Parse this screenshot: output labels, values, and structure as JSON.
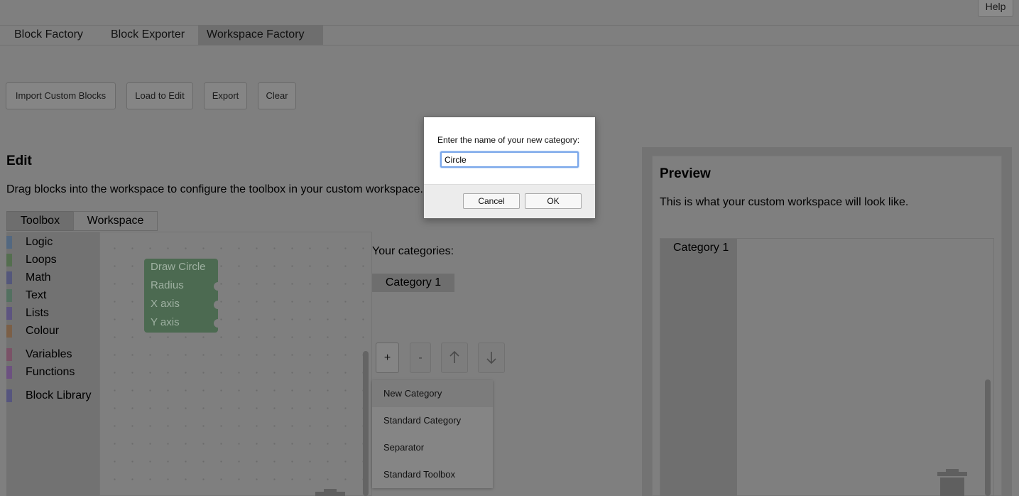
{
  "header": {
    "help_label": "Help"
  },
  "tabs": [
    {
      "label": "Block Factory",
      "active": false
    },
    {
      "label": "Block Exporter",
      "active": false
    },
    {
      "label": "Workspace Factory",
      "active": true
    }
  ],
  "actions": {
    "import": "Import Custom Blocks",
    "load": "Load to Edit",
    "export": "Export",
    "clear": "Clear"
  },
  "edit": {
    "title": "Edit",
    "description": "Drag blocks into the workspace to configure the toolbox in your custom workspace.",
    "subtabs": [
      "Toolbox",
      "Workspace"
    ],
    "categories": [
      {
        "label": "Logic",
        "color": "#536880"
      },
      {
        "label": "Loops",
        "color": "#546e4f"
      },
      {
        "label": "Math",
        "color": "#54577b"
      },
      {
        "label": "Text",
        "color": "#537060"
      },
      {
        "label": "Lists",
        "color": "#5d5480"
      },
      {
        "label": "Colour",
        "color": "#7b5f47"
      },
      {
        "label": "Variables",
        "color": "#7a5267"
      },
      {
        "label": "Functions",
        "color": "#6c5180"
      },
      {
        "label": "Block Library",
        "color": "#56557e"
      }
    ],
    "block": {
      "title": "Draw Circle",
      "inputs": [
        "Radius",
        "X axis",
        "Y axis"
      ]
    }
  },
  "categories_panel": {
    "heading": "Your categories:",
    "items": [
      "Category 1"
    ],
    "controls": {
      "add": "+",
      "remove": "-",
      "up": "↑",
      "down": "↓"
    },
    "menu": [
      "New Category",
      "Standard Category",
      "Separator",
      "Standard Toolbox"
    ]
  },
  "preview": {
    "title": "Preview",
    "description": "This is what your custom workspace will look like.",
    "category": "Category 1"
  },
  "dialog": {
    "message": "Enter the name of your new category:",
    "input_value": "Circle",
    "cancel": "Cancel",
    "ok": "OK"
  }
}
